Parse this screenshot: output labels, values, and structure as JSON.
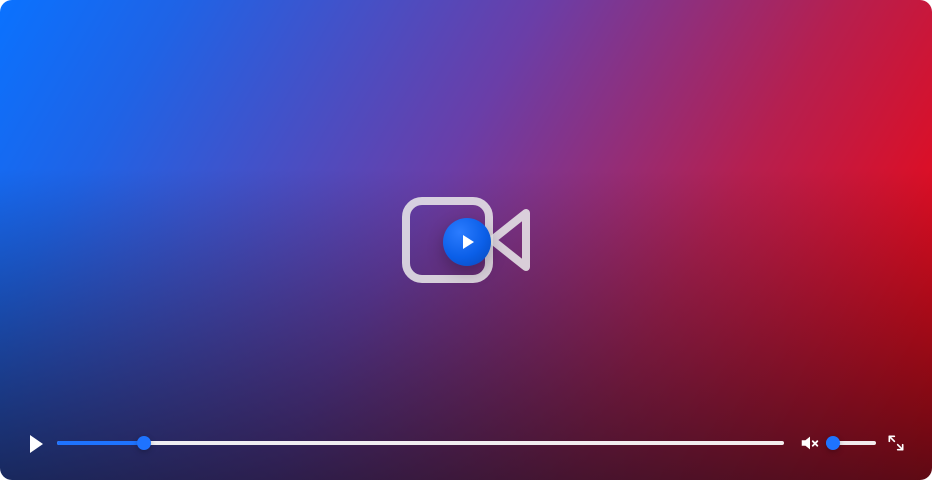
{
  "player": {
    "theme": {
      "gradient_left": "#0a72ff",
      "gradient_right": "#ff0000",
      "accent": "#1e73ff",
      "track": "#ffffff"
    },
    "center": {
      "camera_icon": "video-camera-icon",
      "play_icon": "play-icon"
    },
    "controls": {
      "play_icon": "play-icon",
      "mute_icon": "volume-muted-icon",
      "fullscreen_icon": "fullscreen-icon",
      "progress_fraction": 0.12,
      "volume_fraction": 0.14
    }
  }
}
